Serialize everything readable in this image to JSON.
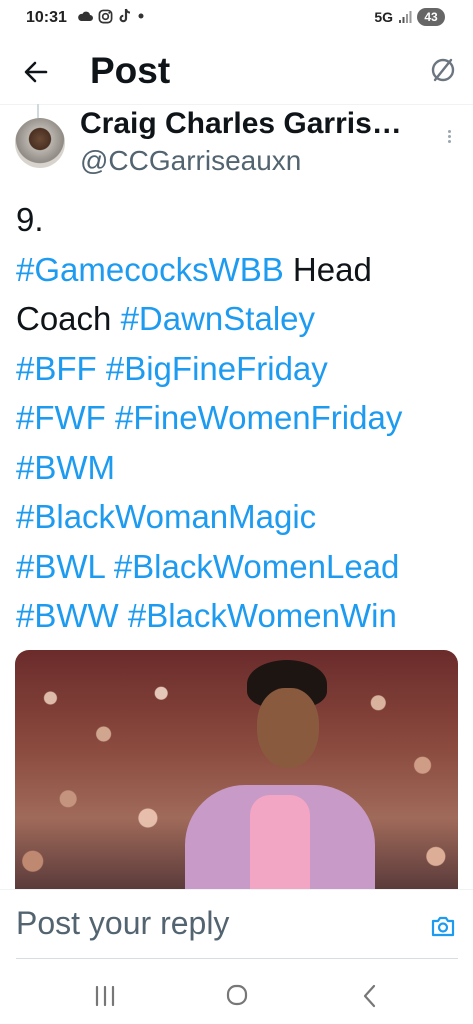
{
  "status_bar": {
    "time": "10:31",
    "network": "5G",
    "battery": "43",
    "notification_icons": [
      "cloud-icon",
      "instagram-icon",
      "tiktok-icon",
      "dot-icon"
    ]
  },
  "header": {
    "title": "Post",
    "back_icon": "arrow-left-icon",
    "action_icon": "prohibit-icon"
  },
  "post": {
    "author_name": "Craig Charles Garris…",
    "author_handle": "@CCGarriseauxn",
    "text_runs": [
      {
        "t": "9.\n",
        "tag": false
      },
      {
        "t": "#GamecocksWBB",
        "tag": true
      },
      {
        "t": " Head\nCoach ",
        "tag": false
      },
      {
        "t": "#DawnStaley",
        "tag": true
      },
      {
        "t": "\n",
        "tag": false
      },
      {
        "t": "#BFF",
        "tag": true
      },
      {
        "t": " ",
        "tag": false
      },
      {
        "t": "#BigFineFriday",
        "tag": true
      },
      {
        "t": "\n",
        "tag": false
      },
      {
        "t": "#FWF",
        "tag": true
      },
      {
        "t": " ",
        "tag": false
      },
      {
        "t": "#FineWomenFriday",
        "tag": true
      },
      {
        "t": "\n",
        "tag": false
      },
      {
        "t": "#BWM",
        "tag": true
      },
      {
        "t": "\n",
        "tag": false
      },
      {
        "t": "#BlackWomanMagic",
        "tag": true
      },
      {
        "t": "\n",
        "tag": false
      },
      {
        "t": "#BWL",
        "tag": true
      },
      {
        "t": " ",
        "tag": false
      },
      {
        "t": "#BlackWomenLead",
        "tag": true
      },
      {
        "t": "\n",
        "tag": false
      },
      {
        "t": "#BWW",
        "tag": true
      },
      {
        "t": " ",
        "tag": false
      },
      {
        "t": "#BlackWomenWin",
        "tag": true
      }
    ]
  },
  "reply": {
    "placeholder": "Post your reply",
    "camera_icon": "camera-icon"
  },
  "nav": {
    "icons": [
      "recent-apps-icon",
      "home-icon",
      "back-icon"
    ]
  },
  "colors": {
    "hashtag": "#1d9bf0",
    "text": "#0f1419",
    "secondary": "#536471"
  }
}
